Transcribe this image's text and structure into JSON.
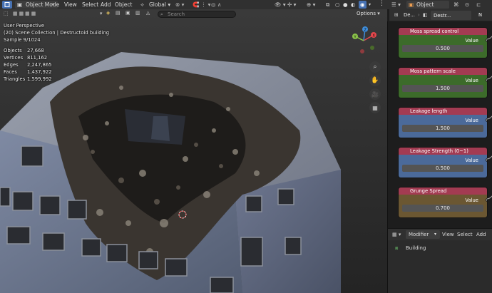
{
  "header": {
    "mode_label": "Object Mode",
    "menus": [
      "View",
      "Select",
      "Add",
      "Object"
    ],
    "transform_label": "Global",
    "props_editor_label": "Object",
    "options_label": "Options"
  },
  "viewport": {
    "search_placeholder": "Search",
    "stats_header": [
      "User Perspective",
      "(20) Scene Collection | Destructoid building",
      "Sample 9/1024"
    ],
    "stats": [
      {
        "label": "Objects",
        "value": "27,668"
      },
      {
        "label": "Vertices",
        "value": "811,162"
      },
      {
        "label": "Edges",
        "value": "2,247,865"
      },
      {
        "label": "Faces",
        "value": "1,437,922"
      },
      {
        "label": "Triangles",
        "value": "1,599,992"
      }
    ],
    "gizmo_axes": [
      "X",
      "Y",
      "Z"
    ]
  },
  "sidebar": {
    "breadcrumb": [
      "De...",
      "Destr...",
      "N"
    ],
    "nodes": [
      {
        "title": "Moss spread control",
        "output": "Value",
        "value": "0.500",
        "header_color": "#a33b52",
        "body_color": "#3c6b2a"
      },
      {
        "title": "Moss pattern scale",
        "output": "Value",
        "value": "1.500",
        "header_color": "#a33b52",
        "body_color": "#3c6b2a"
      },
      {
        "title": "Leakage length",
        "output": "Value",
        "value": "1.500",
        "header_color": "#a33b52",
        "body_color": "#4b6a9a"
      },
      {
        "title": "Leakage Strength (0~1)",
        "output": "Value",
        "value": "0.500",
        "header_color": "#a33b52",
        "body_color": "#4b6a9a"
      },
      {
        "title": "Grunge Spread",
        "output": "Value",
        "value": "0.700",
        "header_color": "#a33b52",
        "body_color": "#6b5732"
      }
    ]
  },
  "modifier_panel": {
    "dropdown_label": "Modifier",
    "menus": [
      "View",
      "Select",
      "Add"
    ],
    "item_label": "Building"
  },
  "colors": {
    "accent": "#4772b3",
    "x_axis": "#e5484d",
    "y_axis": "#8bc34a",
    "z_axis": "#3f8edc"
  }
}
